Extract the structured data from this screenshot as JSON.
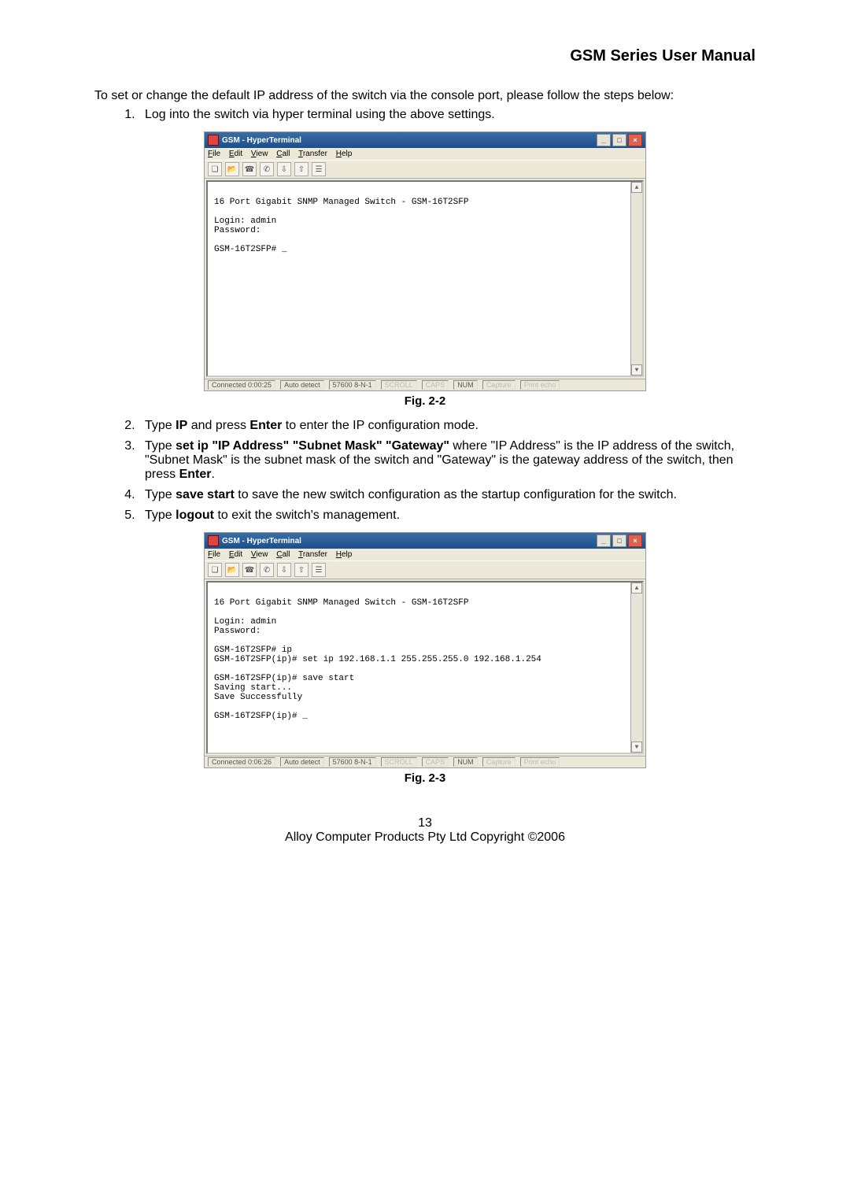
{
  "header": {
    "title": "GSM Series User Manual"
  },
  "intro": "To set or change the default IP address of the switch via the console port, please follow the steps below:",
  "steps1": {
    "start": 1,
    "items": [
      {
        "html": "Log into the switch via hyper terminal using the above settings."
      }
    ]
  },
  "hyperterminal": {
    "title": "GSM - HyperTerminal",
    "menus": [
      "File",
      "Edit",
      "View",
      "Call",
      "Transfer",
      "Help"
    ],
    "status": {
      "conn1": "Connected 0:00:25",
      "conn2": "Connected 0:06:26",
      "detect": "Auto detect",
      "port": "57600 8-N-1",
      "scroll": "SCROLL",
      "caps": "CAPS",
      "num": "NUM",
      "capture": "Capture",
      "printecho": "Print echo"
    }
  },
  "terminal1": "\n16 Port Gigabit SNMP Managed Switch - GSM-16T2SFP\n\nLogin: admin\nPassword:\n\nGSM-16T2SFP# _",
  "terminal2": "\n16 Port Gigabit SNMP Managed Switch - GSM-16T2SFP\n\nLogin: admin\nPassword:\n\nGSM-16T2SFP# ip\nGSM-16T2SFP(ip)# set ip 192.168.1.1 255.255.255.0 192.168.1.254\n\nGSM-16T2SFP(ip)# save start\nSaving start...\nSave Successfully\n\nGSM-16T2SFP(ip)# _",
  "captions": {
    "fig22": "Fig. 2-2",
    "fig23": "Fig. 2-3"
  },
  "steps2": {
    "start": 2,
    "items": [
      {
        "pre": "Type ",
        "b1": "IP",
        "mid1": " and press ",
        "b2": "Enter",
        "post": " to enter the IP configuration mode."
      },
      {
        "pre": "Type ",
        "b1": "set ip \"IP Address\" \"Subnet Mask\" \"Gateway\"",
        "post": " where \"IP Address\" is the IP address of the switch, \"Subnet Mask\" is the subnet mask of the switch and \"Gateway\" is the gateway address of the switch, then press ",
        "b2": "Enter",
        "post2": "."
      },
      {
        "pre": "Type ",
        "b1": "save start",
        "post": " to save the new switch configuration as the startup configuration for the switch."
      },
      {
        "pre": "Type ",
        "b1": "logout",
        "post": " to exit the switch's management."
      }
    ]
  },
  "footer": {
    "pagenum": "13",
    "copyright": "Alloy Computer Products Pty Ltd Copyright ©2006"
  }
}
